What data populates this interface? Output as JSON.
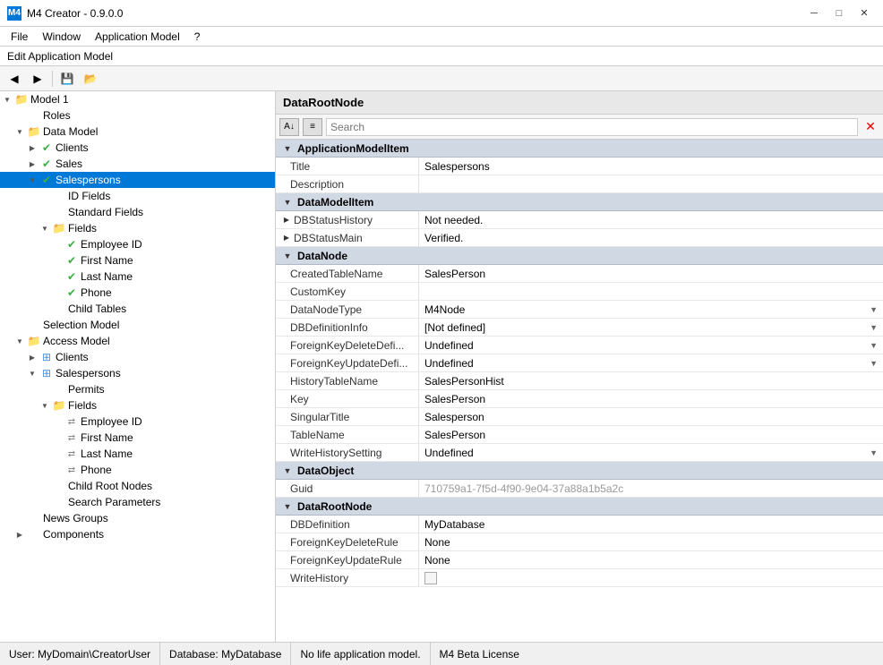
{
  "titleBar": {
    "appIcon": "M4",
    "title": "M4 Creator - 0.9.0.0",
    "minBtn": "─",
    "maxBtn": "□",
    "closeBtn": "✕"
  },
  "menuBar": {
    "items": [
      "File",
      "Window",
      "Application Model",
      "?"
    ]
  },
  "editBar": {
    "label": "Edit Application Model"
  },
  "rightHeader": {
    "title": "DataRootNode"
  },
  "searchBar": {
    "placeholder": "Search",
    "clearBtn": "✕"
  },
  "tree": {
    "nodes": [
      {
        "indent": 0,
        "expand": "▼",
        "icon": "folder",
        "label": "Model 1",
        "selected": false
      },
      {
        "indent": 1,
        "expand": "",
        "icon": "plain",
        "label": "Roles",
        "selected": false
      },
      {
        "indent": 1,
        "expand": "▼",
        "icon": "folder",
        "label": "Data Model",
        "selected": false
      },
      {
        "indent": 2,
        "expand": "▶",
        "icon": "green-check",
        "label": "Clients",
        "selected": false
      },
      {
        "indent": 2,
        "expand": "▶",
        "icon": "green-check",
        "label": "Sales",
        "selected": false
      },
      {
        "indent": 2,
        "expand": "▼",
        "icon": "green-check",
        "label": "Salespersons",
        "selected": true
      },
      {
        "indent": 3,
        "expand": "",
        "icon": "plain",
        "label": "ID Fields",
        "selected": false
      },
      {
        "indent": 3,
        "expand": "",
        "icon": "plain",
        "label": "Standard Fields",
        "selected": false
      },
      {
        "indent": 3,
        "expand": "▼",
        "icon": "folder",
        "label": "Fields",
        "selected": false
      },
      {
        "indent": 4,
        "expand": "",
        "icon": "green-check",
        "label": "Employee ID",
        "selected": false
      },
      {
        "indent": 4,
        "expand": "",
        "icon": "green-check",
        "label": "First Name",
        "selected": false
      },
      {
        "indent": 4,
        "expand": "",
        "icon": "green-check",
        "label": "Last Name",
        "selected": false
      },
      {
        "indent": 4,
        "expand": "",
        "icon": "green-check",
        "label": "Phone",
        "selected": false
      },
      {
        "indent": 3,
        "expand": "",
        "icon": "plain",
        "label": "Child Tables",
        "selected": false
      },
      {
        "indent": 1,
        "expand": "",
        "icon": "plain",
        "label": "Selection Model",
        "selected": false
      },
      {
        "indent": 1,
        "expand": "▼",
        "icon": "folder",
        "label": "Access Model",
        "selected": false
      },
      {
        "indent": 2,
        "expand": "▶",
        "icon": "db-icon",
        "label": "Clients",
        "selected": false
      },
      {
        "indent": 2,
        "expand": "▼",
        "icon": "db-icon",
        "label": "Salespersons",
        "selected": false
      },
      {
        "indent": 3,
        "expand": "",
        "icon": "plain",
        "label": "Permits",
        "selected": false
      },
      {
        "indent": 3,
        "expand": "▼",
        "icon": "folder",
        "label": "Fields",
        "selected": false
      },
      {
        "indent": 4,
        "expand": "",
        "icon": "arrows",
        "label": "Employee ID",
        "selected": false
      },
      {
        "indent": 4,
        "expand": "",
        "icon": "arrows",
        "label": "First Name",
        "selected": false
      },
      {
        "indent": 4,
        "expand": "",
        "icon": "arrows",
        "label": "Last Name",
        "selected": false
      },
      {
        "indent": 4,
        "expand": "",
        "icon": "arrows",
        "label": "Phone",
        "selected": false
      },
      {
        "indent": 3,
        "expand": "",
        "icon": "plain",
        "label": "Child Root Nodes",
        "selected": false
      },
      {
        "indent": 3,
        "expand": "",
        "icon": "plain",
        "label": "Search Parameters",
        "selected": false
      },
      {
        "indent": 1,
        "expand": "",
        "icon": "plain",
        "label": "News Groups",
        "selected": false
      },
      {
        "indent": 1,
        "expand": "▶",
        "icon": "plain",
        "label": "Components",
        "selected": false
      }
    ]
  },
  "properties": {
    "sections": [
      {
        "name": "ApplicationModelItem",
        "rows": [
          {
            "name": "Title",
            "value": "Salespersons",
            "type": "text"
          },
          {
            "name": "Description",
            "value": "",
            "type": "text"
          }
        ]
      },
      {
        "name": "DataModelItem",
        "rows": [
          {
            "name": "DBStatusHistory",
            "value": "Not needed.",
            "type": "expand",
            "expandable": true
          },
          {
            "name": "DBStatusMain",
            "value": "Verified.",
            "type": "expand",
            "expandable": true
          }
        ]
      },
      {
        "name": "DataNode",
        "rows": [
          {
            "name": "CreatedTableName",
            "value": "SalesPerson",
            "type": "text"
          },
          {
            "name": "CustomKey",
            "value": "",
            "type": "text"
          },
          {
            "name": "DataNodeType",
            "value": "M4Node",
            "type": "dropdown"
          },
          {
            "name": "DBDefinitionInfo",
            "value": "[Not defined]",
            "type": "dropdown"
          },
          {
            "name": "ForeignKeyDeleteDefi...",
            "value": "Undefined",
            "type": "dropdown"
          },
          {
            "name": "ForeignKeyUpdateDefi...",
            "value": "Undefined",
            "type": "dropdown"
          },
          {
            "name": "HistoryTableName",
            "value": "SalesPersonHist",
            "type": "text"
          },
          {
            "name": "Key",
            "value": "SalesPerson",
            "type": "text"
          },
          {
            "name": "SingularTitle",
            "value": "Salesperson",
            "type": "text"
          },
          {
            "name": "TableName",
            "value": "SalesPerson",
            "type": "text"
          },
          {
            "name": "WriteHistorySetting",
            "value": "Undefined",
            "type": "dropdown"
          }
        ]
      },
      {
        "name": "DataObject",
        "rows": [
          {
            "name": "Guid",
            "value": "710759a1-7f5d-4f90-9e04-37a88a1b5a2c",
            "type": "guid"
          }
        ]
      },
      {
        "name": "DataRootNode",
        "rows": [
          {
            "name": "DBDefinition",
            "value": "MyDatabase",
            "type": "text"
          },
          {
            "name": "ForeignKeyDeleteRule",
            "value": "None",
            "type": "text"
          },
          {
            "name": "ForeignKeyUpdateRule",
            "value": "None",
            "type": "text"
          },
          {
            "name": "WriteHistory",
            "value": "",
            "type": "checkbox"
          }
        ]
      }
    ]
  },
  "statusBar": {
    "user": "User: MyDomain\\CreatorUser",
    "database": "Database: MyDatabase",
    "appModel": "No life application model.",
    "license": "M4 Beta License"
  }
}
